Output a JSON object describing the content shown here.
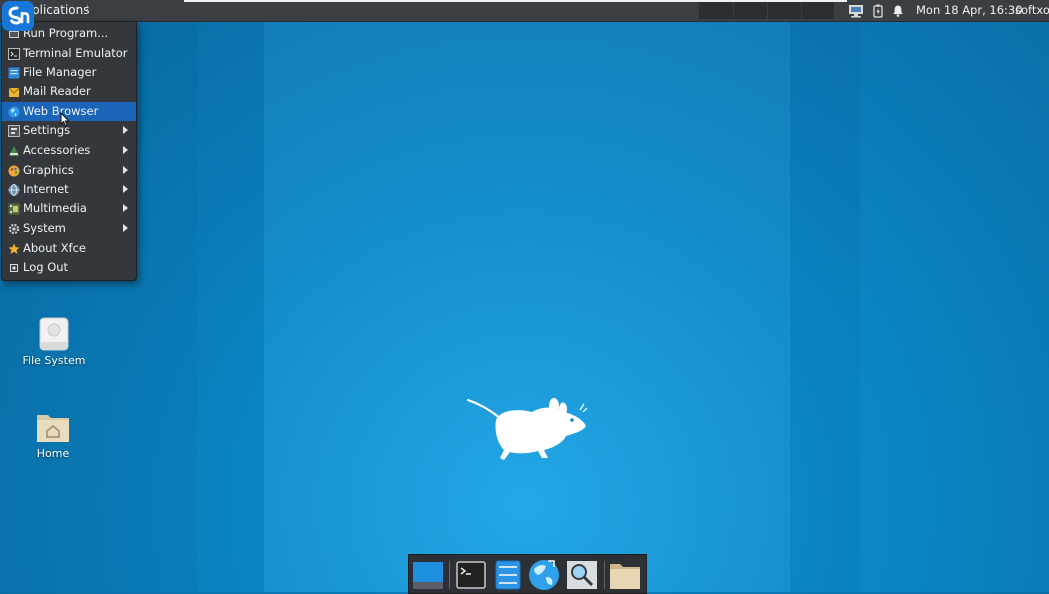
{
  "top_panel": {
    "applications_label": "plications",
    "applications_sep": "⋮",
    "clock": "Mon 18 Apr, 16:30",
    "user": "softxos",
    "tray_icons": [
      "network-icon",
      "battery-icon",
      "notification-bell-icon"
    ]
  },
  "menu": {
    "items": [
      {
        "label": "Run Program...",
        "icon": "run-icon"
      },
      {
        "label": "Terminal Emulator",
        "icon": "terminal-icon"
      },
      {
        "label": "File Manager",
        "icon": "file-manager-icon"
      },
      {
        "label": "Mail Reader",
        "icon": "mail-icon"
      },
      {
        "label": "Web Browser",
        "icon": "web-browser-icon",
        "selected": true
      },
      {
        "label": "Settings",
        "icon": "settings-icon",
        "submenu": true
      },
      {
        "label": "Accessories",
        "icon": "accessories-icon",
        "submenu": true
      },
      {
        "label": "Graphics",
        "icon": "graphics-icon",
        "submenu": true
      },
      {
        "label": "Internet",
        "icon": "internet-icon",
        "submenu": true
      },
      {
        "label": "Multimedia",
        "icon": "multimedia-icon",
        "submenu": true
      },
      {
        "label": "System",
        "icon": "system-gear-icon",
        "submenu": true
      },
      {
        "label": "About Xfce",
        "icon": "star-icon"
      },
      {
        "label": "Log Out",
        "icon": "log-out-icon"
      }
    ]
  },
  "desktop": {
    "icons": [
      {
        "label": "File System",
        "icon": "drive-icon"
      },
      {
        "label": "Home",
        "icon": "home-folder-icon"
      }
    ]
  },
  "dock": {
    "items": [
      "show-desktop-icon",
      "terminal-icon",
      "file-manager-icon",
      "web-browser-icon",
      "app-finder-icon",
      "folder-icon"
    ]
  },
  "colors": {
    "panel": "#3b3f44",
    "menu_bg": "#34373b",
    "menu_highlight": "#1c64b8",
    "wallpaper": "#0b88c8"
  }
}
